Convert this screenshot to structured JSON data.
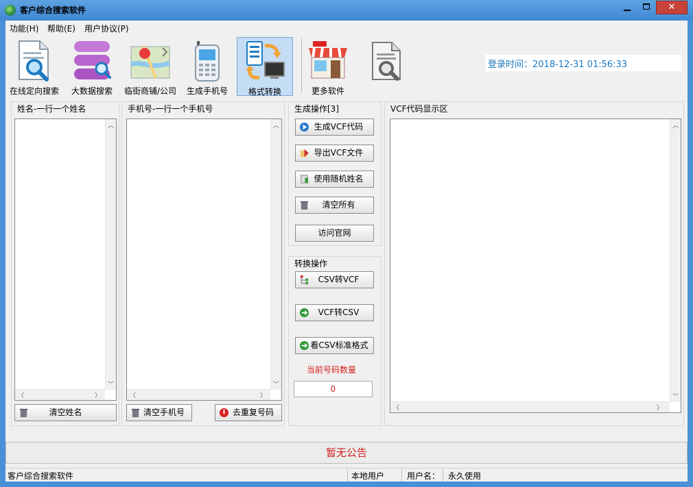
{
  "window": {
    "title": "客户综合搜索软件"
  },
  "menu": [
    {
      "label": "功能(H)"
    },
    {
      "label": "帮助(E)"
    },
    {
      "label": "用户协议(P)"
    }
  ],
  "toolbar": [
    {
      "label": "在线定向搜索",
      "icon": "document-search-icon"
    },
    {
      "label": "大数据搜索",
      "icon": "database-search-icon"
    },
    {
      "label": "临街商铺/公司",
      "icon": "map-icon"
    },
    {
      "label": "生成手机号",
      "icon": "phone-icon"
    },
    {
      "label": "格式转换",
      "icon": "convert-icon",
      "active": true
    },
    {
      "label": "更多软件",
      "icon": "shop-icon"
    },
    {
      "label": "",
      "icon": "document-magnifier-icon"
    }
  ],
  "login": {
    "text": "登录时间：2018-12-31 01:56:33"
  },
  "names_panel": {
    "title": "姓名-一行一个姓名",
    "clear_label": "清空姓名"
  },
  "phones_panel": {
    "title": "手机号-一行一个手机号",
    "clear_label": "清空手机号",
    "dedupe_label": "去重复号码"
  },
  "generate_panel": {
    "title": "生成操作[3]",
    "buttons": [
      "生成VCF代码",
      "导出VCF文件",
      "使用随机姓名",
      "清空所有",
      "访问官网"
    ]
  },
  "convert_panel": {
    "title": "转换操作",
    "buttons": [
      "CSV转VCF",
      "VCF转CSV",
      "看CSV标准格式"
    ],
    "count_label": "当前号码数量",
    "count_value": "0"
  },
  "vcf_panel": {
    "title": "VCF代码显示区"
  },
  "notice": {
    "text": "暂无公告"
  },
  "status": {
    "app": "客户综合搜索软件",
    "user_type": "本地用户",
    "user_label": "用户名：",
    "license": "永久使用"
  },
  "colors": {
    "accent": "#1a78c2",
    "alert": "#d31e1e",
    "title_bar": "#4a90d6"
  }
}
